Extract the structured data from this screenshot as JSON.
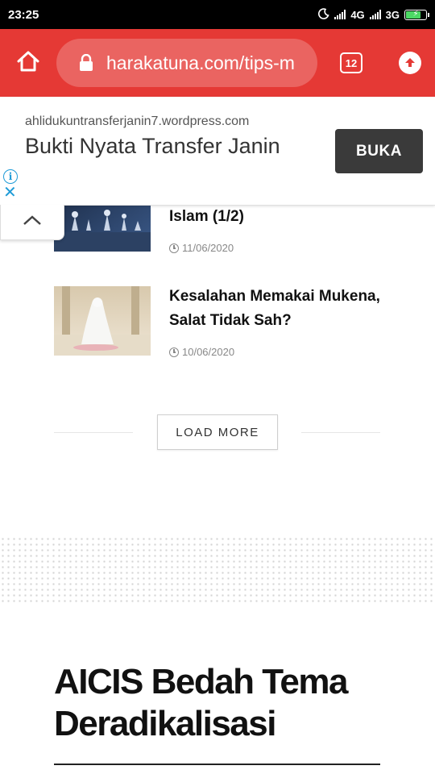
{
  "status_bar": {
    "time": "23:25",
    "network_1": "4G",
    "network_2": "3G"
  },
  "browser": {
    "url": "harakatuna.com/tips-m",
    "tab_count": "12",
    "toolbar_color": "#e53935"
  },
  "ad": {
    "domain": "ahlidukuntransferjanin7.wordpress.com",
    "title": "Bukti Nyata Transfer Janin",
    "button_label": "BUKA"
  },
  "articles": [
    {
      "title": "Islam (1/2)",
      "date": "11/06/2020"
    },
    {
      "title": "Kesalahan Memakai Mukena, Salat Tidak Sah?",
      "date": "10/06/2020"
    }
  ],
  "load_more_label": "LOAD MORE",
  "section": {
    "title": "AICIS Bedah Tema Deradikalisasi"
  }
}
